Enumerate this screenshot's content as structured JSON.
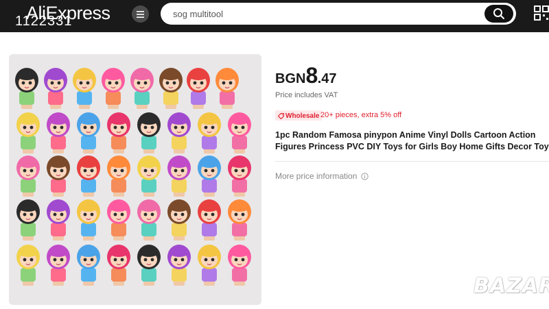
{
  "header": {
    "logo": "AliExpress",
    "overlay_id": "1122331",
    "search": {
      "value": "sog multitool"
    },
    "icons": {
      "menu": "menu-icon",
      "search": "search-icon",
      "qr": "qr-code-icon"
    },
    "background": "#1a1a1a"
  },
  "product": {
    "image_alt": "Assorted Pinypon figure dolls",
    "price": {
      "currency": "BGN",
      "integer": "8",
      "decimal": ".47"
    },
    "vat_note": "Price includes VAT",
    "wholesale": {
      "badge": "Wholesale",
      "offer": "20+ pieces, extra 5% off",
      "color": "#e0202d"
    },
    "title_line1": "1pc Random Famosa pinypon Anime Vinyl Dolls Cartoon Action",
    "title_line2": "Figures Princess PVC DIY Toys for Girls Boy Home Gifts Decor Toys",
    "more_info": "More price information",
    "watermark": "BAZAR"
  }
}
